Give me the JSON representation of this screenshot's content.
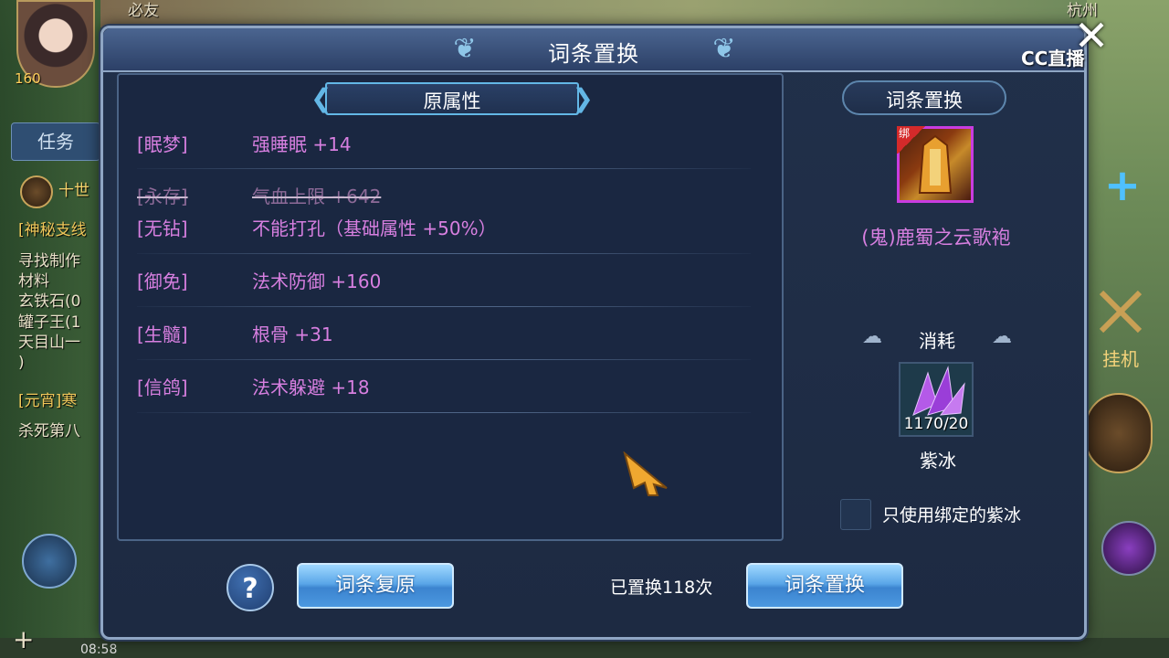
{
  "background": {
    "top_left_text": "必友",
    "top_right_text": "杭州",
    "left_tab": "任务",
    "quest_text": [
      "十世",
      "[神秘支线",
      "寻找制作",
      "材料",
      "玄铁石(0",
      "罐子王(1",
      "天目山一",
      ")",
      "[元宵]寒",
      "杀死第八"
    ],
    "player_level": "160",
    "hangji_label": "挂机",
    "cc_watermark": "CC直播",
    "clock": "08:58"
  },
  "dialog": {
    "title": "词条置换",
    "close_icon": "close-icon"
  },
  "attributes": {
    "header": "原属性",
    "rows": [
      {
        "tag": "[眠梦]",
        "value": "强睡眠 +14",
        "struck": false
      },
      {
        "tag": "[永存]",
        "value": "气血上限 +642",
        "struck": true
      },
      {
        "tag": "[无钻]",
        "value": "不能打孔（基础属性 +50%）",
        "struck": false
      },
      {
        "tag": "[御免]",
        "value": "法术防御 +160",
        "struck": false
      },
      {
        "tag": "[生髓]",
        "value": "根骨 +31",
        "struck": false
      },
      {
        "tag": "[信鸽]",
        "value": "法术躲避 +18",
        "struck": false
      }
    ]
  },
  "right_panel": {
    "header": "词条置换",
    "item": {
      "badge": "绑",
      "name": "(鬼)鹿蜀之云歌袍",
      "border_color": "#c93ce0"
    },
    "consume_header": "消耗",
    "material": {
      "count": "1170/20",
      "name": "紫冰"
    },
    "only_bound_checkbox": {
      "label": "只使用绑定的紫冰",
      "checked": false
    }
  },
  "footer": {
    "help_label": "?",
    "restore_button": "词条复原",
    "swap_count_text": "已置换118次",
    "swap_button": "词条置换"
  },
  "colors": {
    "attribute_text": "#d77fe0",
    "dialog_bg": "#1d2a42",
    "button_blue": "#4b98e0"
  }
}
